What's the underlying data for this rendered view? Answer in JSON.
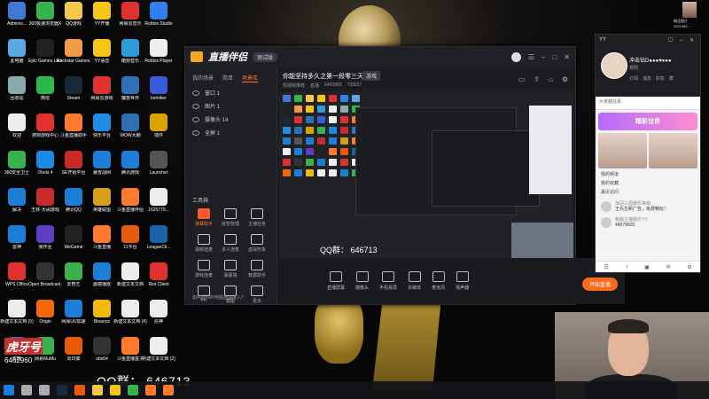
{
  "desktop_icons": [
    {
      "label": "Adminis...",
      "color": "#3d7bd6"
    },
    {
      "label": "360极速浏览器X",
      "color": "#37b24d"
    },
    {
      "label": "QQ游戏",
      "color": "#f2c94c"
    },
    {
      "label": "YY开播",
      "color": "#f5c518"
    },
    {
      "label": "网易云音乐",
      "color": "#e03131"
    },
    {
      "label": "Roblox Studio",
      "color": "#2f80ed"
    },
    {
      "label": "此电脑",
      "color": "#5aa9e6"
    },
    {
      "label": "Epic Games Launcher",
      "color": "#222"
    },
    {
      "label": "Rockstar Games...",
      "color": "#f2994a"
    },
    {
      "label": "YY语音",
      "color": "#f5c518"
    },
    {
      "label": "酷狗音乐",
      "color": "#2d9cdb"
    },
    {
      "label": "Roblox Player",
      "color": "#eee"
    },
    {
      "label": "回收站",
      "color": "#8aa"
    },
    {
      "label": "微信",
      "color": "#2db84c"
    },
    {
      "label": "Steam",
      "color": "#1b2838"
    },
    {
      "label": "网易云游戏",
      "color": "#e03131"
    },
    {
      "label": "魔兽世界",
      "color": "#2f6fb3"
    },
    {
      "label": "kemiker",
      "color": "#3b5bdb"
    },
    {
      "label": "欢迎",
      "color": "#eee"
    },
    {
      "label": "搜狗游戏中心",
      "color": "#e03131"
    },
    {
      "label": "斗鱼直播助手",
      "color": "#ff7a2d"
    },
    {
      "label": "快乐平台",
      "color": "#228be6"
    },
    {
      "label": "WOW大脚",
      "color": "#2f6fb3"
    },
    {
      "label": "插件",
      "color": "#d9a400"
    },
    {
      "label": "360安全卫士",
      "color": "#37b24d"
    },
    {
      "label": "iTools 4",
      "color": "#1e88e5"
    },
    {
      "label": "SE开始平台",
      "color": "#c92a2a"
    },
    {
      "label": "暴雪战网",
      "color": "#1c7ed6"
    },
    {
      "label": "腾讯游戏",
      "color": "#1c7ed6"
    },
    {
      "label": "Launcher",
      "color": "#555"
    },
    {
      "label": "解决",
      "color": "#1c7ed6"
    },
    {
      "label": "王林·大闹游戏",
      "color": "#c92a2a"
    },
    {
      "label": "腾讯QQ",
      "color": "#1c7ed6"
    },
    {
      "label": "英雄联盟",
      "color": "#d4a017"
    },
    {
      "label": "斗鱼直播伴侣",
      "color": "#ff7a2d"
    },
    {
      "label": "1625779...",
      "color": "#eee"
    },
    {
      "label": "雷神",
      "color": "#1c7ed6"
    },
    {
      "label": "我作业",
      "color": "#5f3dc4"
    },
    {
      "label": "WeGame",
      "color": "#222"
    },
    {
      "label": "斗鱼直播",
      "color": "#ff7a2d"
    },
    {
      "label": "11平台",
      "color": "#e8590c"
    },
    {
      "label": "LeagueCli...",
      "color": "#1864ab"
    },
    {
      "label": "WPS Office",
      "color": "#e03131"
    },
    {
      "label": "Open Broadcast...",
      "color": "#333"
    },
    {
      "label": "爱奇艺",
      "color": "#37b24d"
    },
    {
      "label": "画镜播放",
      "color": "#1c7ed6"
    },
    {
      "label": "新建文本文档",
      "color": "#eee"
    },
    {
      "label": "Riot Client",
      "color": "#e03131"
    },
    {
      "label": "新建文本文档 (5)",
      "color": "#eee"
    },
    {
      "label": "Origin",
      "color": "#f76707"
    },
    {
      "label": "网易UU加速",
      "color": "#1c7ed6"
    },
    {
      "label": "Binance",
      "color": "#f0b90b"
    },
    {
      "label": "新建文本文档 (4)",
      "color": "#eee"
    },
    {
      "label": "原神",
      "color": "#eee"
    },
    {
      "label": "优酷",
      "color": "#1c7ed6"
    },
    {
      "label": "网易MuMu",
      "color": "#37b24d"
    },
    {
      "label": "向日葵",
      "color": "#e8590c"
    },
    {
      "label": "obs64",
      "color": "#333"
    },
    {
      "label": "斗鱼直播盒子",
      "color": "#ff7a2d"
    },
    {
      "label": "新建文本文档 (2)",
      "color": "#eee"
    }
  ],
  "app": {
    "brand": "直播伴侣",
    "brand_badge": "测试版",
    "left_tabs": [
      "我的场景",
      "简单",
      "场景库"
    ],
    "sources": [
      "窗口 1",
      "图片 1",
      "摄像头 14",
      "全屏 1"
    ],
    "tool_section": "工具箱",
    "tools": [
      "弹幕助手",
      "房管管理",
      "主播任务",
      "视频连麦",
      "多人连麦",
      "虚拟形象",
      "游戏连麦",
      "弹幕墙",
      "数据助手",
      "PK",
      "截图",
      "更多"
    ],
    "footer_note": "如何把你的电脑画面接入？",
    "room_title": "你能坚持多久之第一段零三天！",
    "room_chip": "游戏",
    "room_meta": [
      "短视频推荐",
      "直播",
      "6462960",
      "733527"
    ],
    "preview_overlay": "QQ群：  646713",
    "bottom_tools": [
      "直播屏幕",
      "摄像头",
      "手机投屏",
      "多媒体",
      "麦克风",
      "扬声器"
    ],
    "go_live": "开始直播"
  },
  "yy": {
    "app_name": "YY",
    "nickname": "冲击钻D●●●♥●●●",
    "sub": "规则",
    "toolbar": [
      "订阅",
      "消息",
      "好友",
      "群"
    ],
    "search_placeholder": "大家都在看",
    "banner": "精彩世界",
    "menu": [
      "我的频道",
      "我的收藏",
      "最近访问"
    ],
    "messages": [
      {
        "name": "加冠三国娱乐等级...",
        "text": "王先生新广告，免费畅玩！"
      },
      {
        "name": "萌萌主播娱乐YY",
        "text": "46078600"
      }
    ],
    "footer_icons": [
      "☰",
      "♪",
      "▣",
      "✉",
      "⚙"
    ]
  },
  "top_user": {
    "label": "精品图片 2021082..."
  },
  "watermark": {
    "logo": "虎牙号",
    "id": "6462960"
  },
  "qq_group": "QQ群：  646713",
  "taskbar": [
    {
      "name": "start",
      "color": "#1c7ed6"
    },
    {
      "name": "search",
      "color": "#aaa"
    },
    {
      "name": "task-view",
      "color": "#aaa"
    },
    {
      "name": "steam",
      "color": "#1b2838"
    },
    {
      "name": "chrome",
      "color": "#e8590c"
    },
    {
      "name": "folder",
      "color": "#f2c94c"
    },
    {
      "name": "yy",
      "color": "#f5c518"
    },
    {
      "name": "app2",
      "color": "#37b24d"
    },
    {
      "name": "app3",
      "color": "#ff7a2d"
    },
    {
      "name": "live",
      "color": "#ff7a2d"
    }
  ]
}
